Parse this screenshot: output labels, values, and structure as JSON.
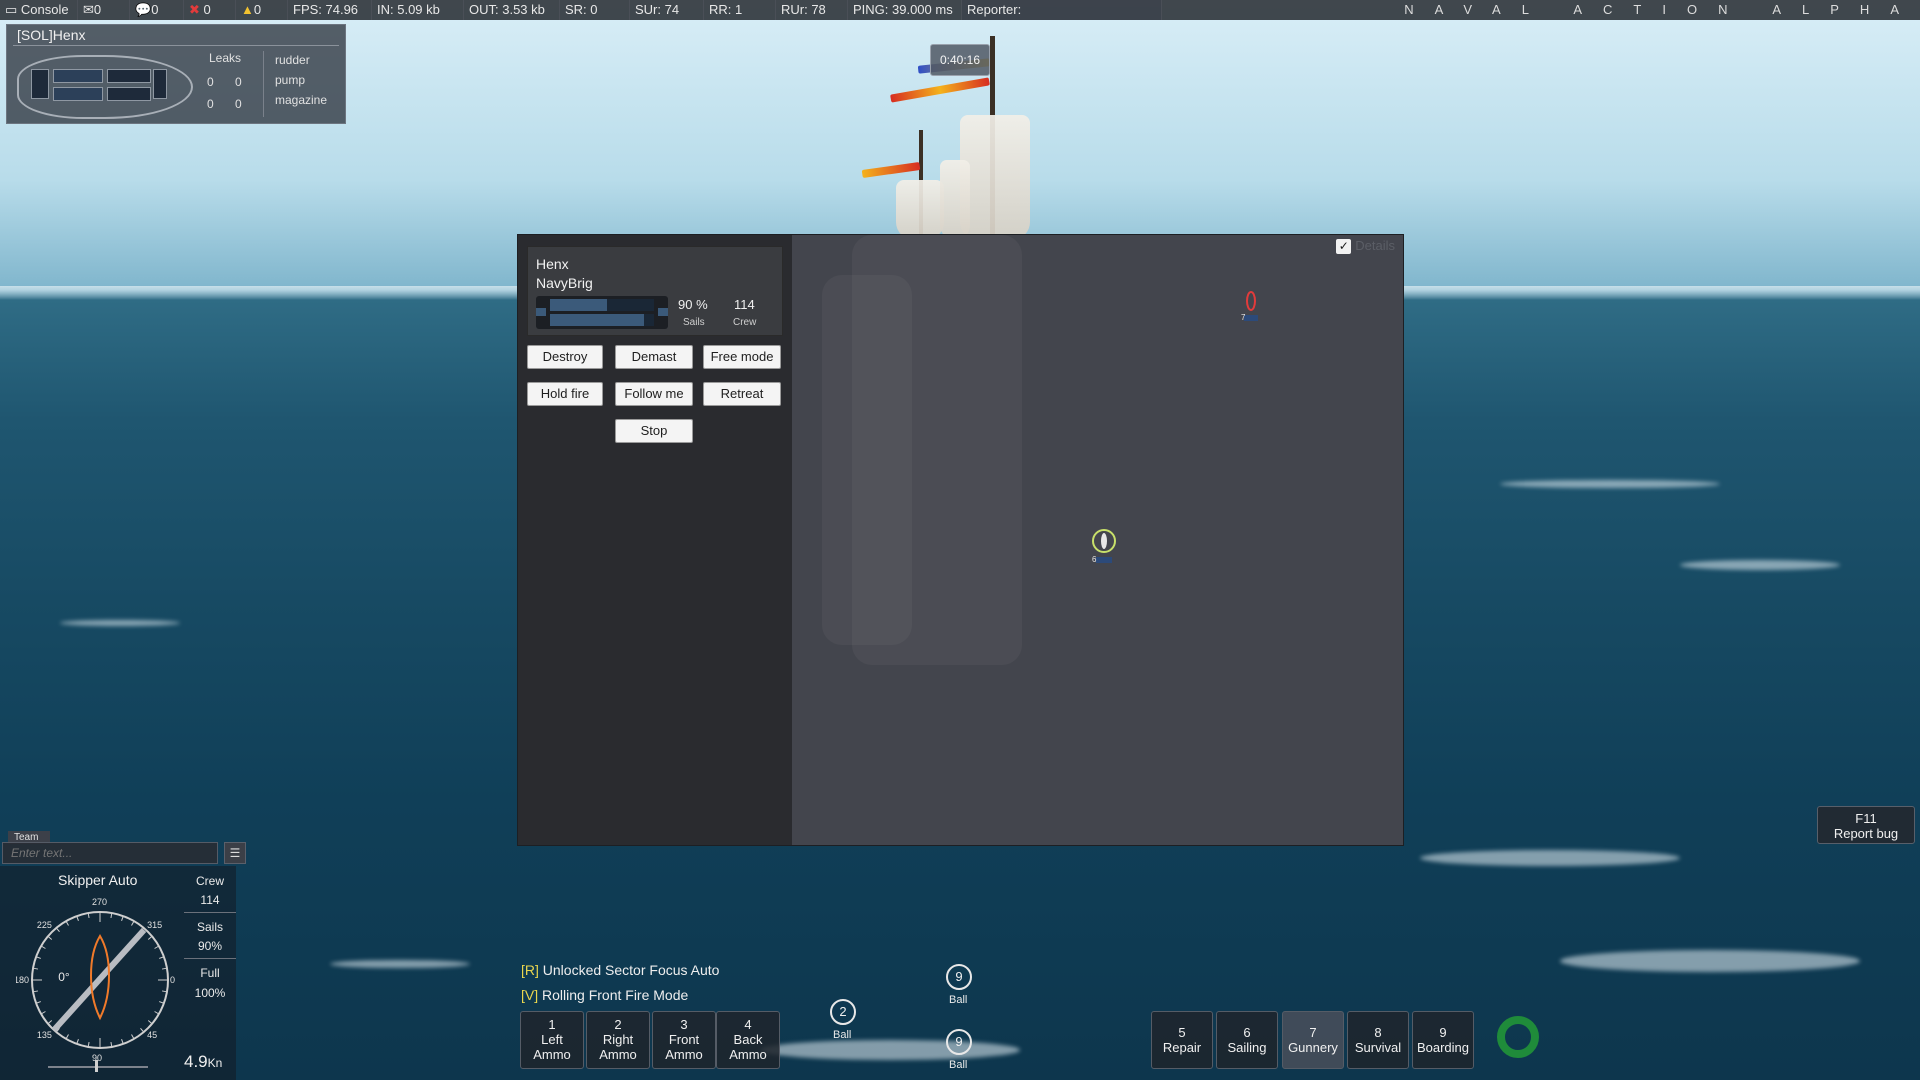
{
  "topbar": {
    "console": "Console",
    "mail_count": "0",
    "chat_count": "0",
    "error_count": "0",
    "warning_count": "0",
    "fps": "FPS: 74.96",
    "in": "IN: 5.09 kb",
    "out": "OUT: 3.53 kb",
    "sr": "SR: 0",
    "sur": "SUr: 74",
    "rr": "RR: 1",
    "rur": "RUr: 78",
    "ping": "PING: 39.000 ms",
    "reporter": "Reporter:",
    "game_title": "NAVAL ACTION ALPHA"
  },
  "ship_status": {
    "name": "[SOL]Henx",
    "leaks_label": "Leaks",
    "rows": [
      {
        "a": "0",
        "b": "0",
        "label": "pump"
      },
      {
        "a": "0",
        "b": "0",
        "label": "magazine"
      }
    ],
    "rudder_label": "rudder"
  },
  "timer": "0:40:16",
  "orders_panel": {
    "captain": "Henx",
    "ship_class": "NavyBrig",
    "sails_value": "90 %",
    "sails_label": "Sails",
    "crew_value": "114",
    "crew_label": "Crew",
    "sails_fraction": 0.9,
    "hull_fraction": 0.55,
    "buttons": {
      "destroy": "Destroy",
      "demast": "Demast",
      "free_mode": "Free mode",
      "hold_fire": "Hold fire",
      "follow_me": "Follow me",
      "retreat": "Retreat",
      "stop": "Stop"
    },
    "details_label": "Details",
    "details_checked": true,
    "markers": [
      {
        "number": "7",
        "color": "#e23b3b"
      },
      {
        "number": "6",
        "color": "#c8e06a"
      }
    ]
  },
  "chat": {
    "tab": "Team",
    "placeholder": "Enter text..."
  },
  "skipper": {
    "title": "Skipper Auto",
    "crew_label": "Crew",
    "crew_value": "114",
    "sails_label": "Sails",
    "sails_value": "90%",
    "full_label": "Full",
    "full_value": "100%",
    "heading": "0°",
    "compass_ticks": [
      "270",
      "315",
      "0",
      "45",
      "90",
      "135",
      "180",
      "225"
    ],
    "speed_value": "4.9",
    "speed_unit": "Kn"
  },
  "hints": [
    {
      "key": "[R]",
      "text": " Unlocked Sector Focus Auto"
    },
    {
      "key": "[V]",
      "text": " Rolling Front Fire Mode"
    }
  ],
  "ammo": [
    {
      "num": "1",
      "l1": "Left",
      "l2": "Ammo"
    },
    {
      "num": "2",
      "l1": "Right",
      "l2": "Ammo"
    },
    {
      "num": "3",
      "l1": "Front",
      "l2": "Ammo"
    },
    {
      "num": "4",
      "l1": "Back",
      "l2": "Ammo"
    }
  ],
  "balls": [
    {
      "count": "2",
      "label": "Ball"
    },
    {
      "count": "9",
      "label": "Ball"
    },
    {
      "count": "9",
      "label": "Ball"
    }
  ],
  "skills": [
    {
      "num": "5",
      "label": "Repair"
    },
    {
      "num": "6",
      "label": "Sailing"
    },
    {
      "num": "7",
      "label": "Gunnery"
    },
    {
      "num": "8",
      "label": "Survival"
    },
    {
      "num": "9",
      "label": "Boarding"
    }
  ],
  "report": {
    "key": "F11",
    "label": "Report bug"
  }
}
